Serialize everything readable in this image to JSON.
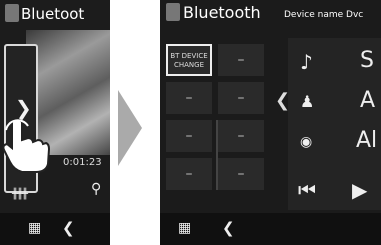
{
  "left_screen": {
    "title": "Bluetoot",
    "time": "0:01:23",
    "icons": [
      "bluetooth-icon",
      "chevron-right-icon",
      "search-icon",
      "equalizer-icon",
      "grid-menu-icon",
      "chevron-left-icon",
      "hand-pointer-icon"
    ]
  },
  "right_screen": {
    "title": "Bluetooth",
    "device_name_label": "Device name",
    "device_name_value": "Dvc",
    "change_button": "BT DEVICE\nCHANGE",
    "placeholder": "–",
    "panel_letters": [
      "S",
      "A",
      "Al"
    ],
    "icons": [
      "bluetooth-icon",
      "music-note-icon",
      "person-icon",
      "disc-icon",
      "previous-track-icon",
      "play-icon",
      "grid-menu-icon",
      "chevron-left-icon"
    ]
  },
  "colors": {
    "screen_bg": "#1b1b1b",
    "text": "#ffffff",
    "arrow": "#aaaaaa"
  }
}
